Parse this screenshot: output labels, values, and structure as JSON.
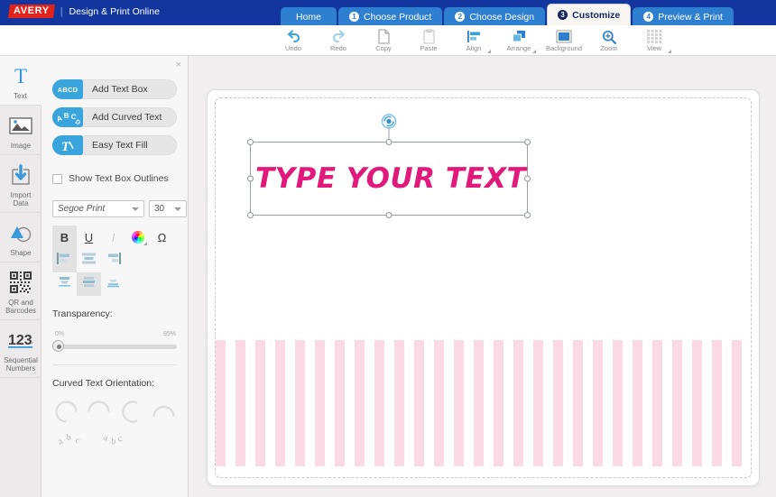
{
  "brand": {
    "logo_text": "AVERY",
    "separator": "|",
    "product_name": "Design & Print Online"
  },
  "tabs": [
    {
      "label": "Home",
      "badge": "",
      "active": false
    },
    {
      "label": "Choose Product",
      "badge": "1",
      "active": false
    },
    {
      "label": "Choose Design",
      "badge": "2",
      "active": false
    },
    {
      "label": "Customize",
      "badge": "3",
      "active": true
    },
    {
      "label": "Preview & Print",
      "badge": "4",
      "active": false
    }
  ],
  "toolbar": {
    "items": [
      {
        "label": "Undo",
        "icon": "undo-icon",
        "dropdown": false
      },
      {
        "label": "Redo",
        "icon": "redo-icon",
        "dropdown": false
      },
      {
        "label": "Copy",
        "icon": "copy-icon",
        "dropdown": false
      },
      {
        "label": "Paste",
        "icon": "paste-icon",
        "dropdown": false
      },
      {
        "label": "Align",
        "icon": "align-icon",
        "dropdown": true
      },
      {
        "label": "Arrange",
        "icon": "arrange-icon",
        "dropdown": true
      },
      {
        "label": "Background",
        "icon": "background-icon",
        "dropdown": false
      },
      {
        "label": "Zoom",
        "icon": "zoom-icon",
        "dropdown": false
      },
      {
        "label": "View",
        "icon": "view-grid-icon",
        "dropdown": true
      }
    ]
  },
  "sidebar": {
    "items": [
      {
        "label": "Text",
        "icon": "text-t-icon",
        "active": true
      },
      {
        "label": "Image",
        "icon": "image-icon",
        "active": false
      },
      {
        "label": "Import\nData",
        "icon": "import-data-icon",
        "active": false
      },
      {
        "label": "Shape",
        "icon": "shape-icon",
        "active": false
      },
      {
        "label": "QR and\nBarcodes",
        "icon": "qr-code-icon",
        "active": false
      },
      {
        "label": "Sequential\nNumbers",
        "icon": "sequential-numbers-icon",
        "active": false
      }
    ],
    "labels": {
      "text": "Text",
      "image": "Image",
      "import_data_line1": "Import",
      "import_data_line2": "Data",
      "shape": "Shape",
      "qr_line1": "QR and",
      "qr_line2": "Barcodes",
      "seq_line1": "Sequential",
      "seq_line2": "Numbers",
      "seq_digits": "123"
    }
  },
  "panel": {
    "close_label": "×",
    "buttons": [
      {
        "label": "Add Text Box",
        "icon_text": "ABCD",
        "icon": "abcd-text-box-icon"
      },
      {
        "label": "Add Curved Text",
        "icon_text": "ABC",
        "icon": "curved-text-icon"
      },
      {
        "label": "Easy Text Fill",
        "icon_text": "T",
        "icon": "easy-text-fill-icon"
      }
    ],
    "show_outlines_label": "Show Text Box Outlines",
    "show_outlines_checked": false,
    "font_family_value": "Segoe Print",
    "font_size_value": "30",
    "format_buttons": [
      {
        "name": "bold",
        "label": "B",
        "active": true,
        "disabled": false
      },
      {
        "name": "underline",
        "label": "U",
        "active": false,
        "disabled": false
      },
      {
        "name": "italic",
        "label": "I",
        "active": false,
        "disabled": true
      },
      {
        "name": "font-color",
        "label": "",
        "active": false,
        "disabled": false
      },
      {
        "name": "special-character",
        "label": "Ω",
        "active": false,
        "disabled": false
      }
    ],
    "align_horizontal": [
      {
        "name": "align-left",
        "active": true
      },
      {
        "name": "align-center",
        "active": false
      },
      {
        "name": "align-right",
        "active": false
      }
    ],
    "align_vertical": [
      {
        "name": "align-top",
        "active": false
      },
      {
        "name": "align-middle",
        "active": true
      },
      {
        "name": "align-bottom",
        "active": false
      }
    ],
    "transparency_label": "Transparency:",
    "transparency_min": "0%",
    "transparency_max": "95%",
    "transparency_value": 0,
    "curved_text_label": "Curved Text Orientation:",
    "curved_options": [
      {
        "name": "arc-up-left"
      },
      {
        "name": "arc-down"
      },
      {
        "name": "arc-left"
      },
      {
        "name": "arc-up"
      }
    ],
    "curved_path_options": [
      {
        "name": "text-path-up",
        "label": "abc"
      },
      {
        "name": "text-path-down",
        "label": "abc"
      }
    ]
  },
  "canvas": {
    "text_box_value": "TYPE YOUR TEXT",
    "text_color": "#e0197a",
    "stripe_color": "#fbd9e5",
    "sheet_background": "#ffffff"
  },
  "colors": {
    "topbar": "#12369e",
    "tab_inactive": "#2f7fd0",
    "tab_active_bg": "#f7f6f2",
    "accent_blue": "#3aa5dc",
    "logo_red": "#e2231a"
  }
}
